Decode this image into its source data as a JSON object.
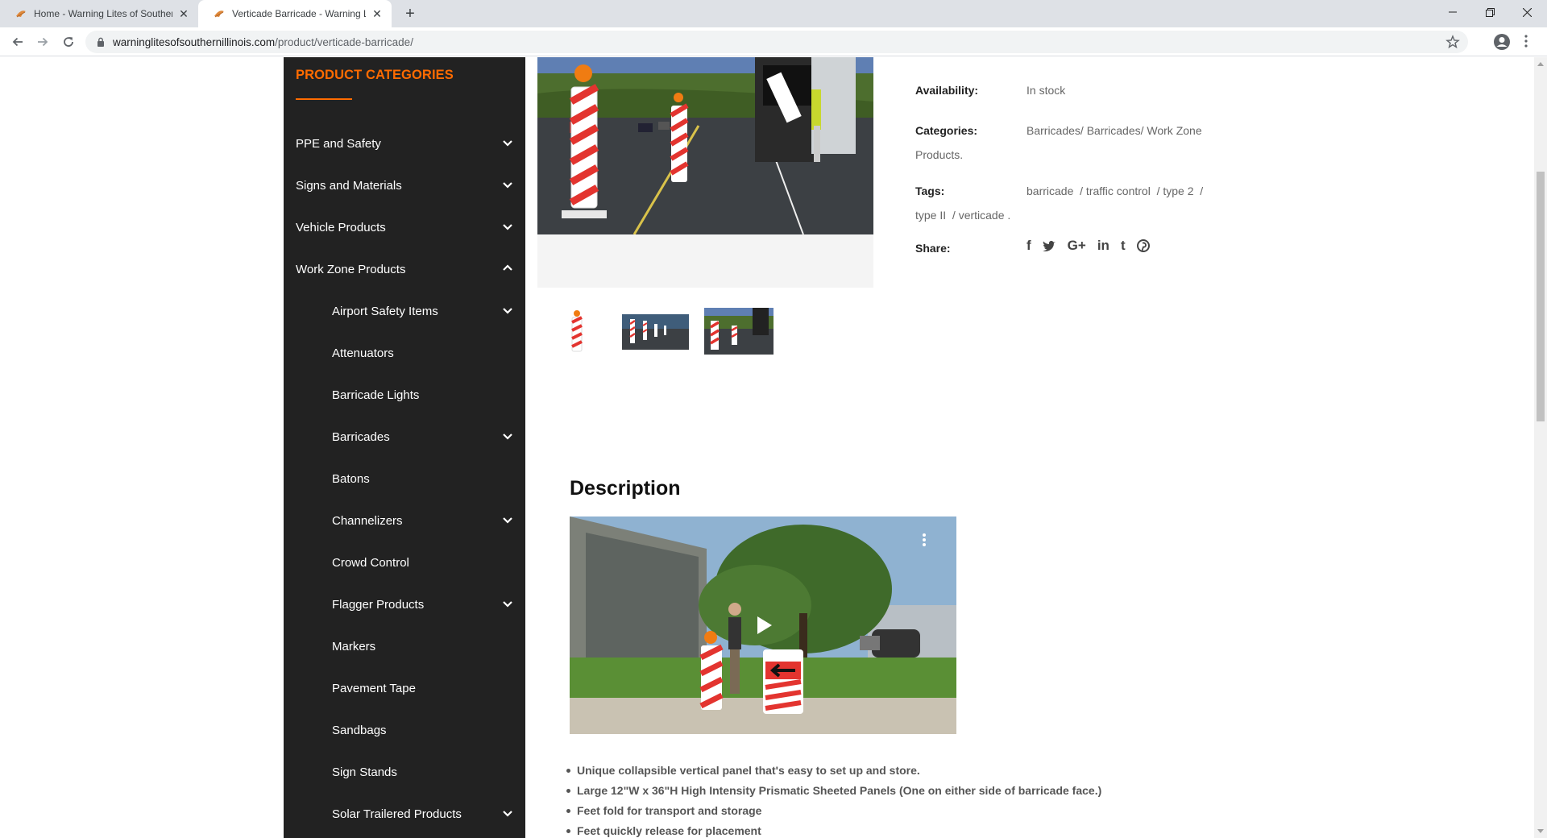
{
  "browser": {
    "tabs": [
      {
        "title": "Home - Warning Lites of Southern Illinois",
        "active": false
      },
      {
        "title": "Verticade Barricade - Warning Lites of Southern Illinois",
        "active": true
      }
    ],
    "url_domain": "warninglitesofsouthernillinois.com",
    "url_path": "/product/verticade-barricade/"
  },
  "sidebar": {
    "title": "PRODUCT CATEGORIES",
    "items": [
      {
        "label": "PPE and Safety",
        "level": 0,
        "expand": "down"
      },
      {
        "label": "Signs and Materials",
        "level": 0,
        "expand": "down"
      },
      {
        "label": "Vehicle Products",
        "level": 0,
        "expand": "down"
      },
      {
        "label": "Work Zone Products",
        "level": 0,
        "expand": "up"
      },
      {
        "label": "Airport Safety Items",
        "level": 1,
        "expand": "down"
      },
      {
        "label": "Attenuators",
        "level": 1,
        "expand": ""
      },
      {
        "label": "Barricade Lights",
        "level": 1,
        "expand": ""
      },
      {
        "label": "Barricades",
        "level": 1,
        "expand": "down"
      },
      {
        "label": "Batons",
        "level": 1,
        "expand": ""
      },
      {
        "label": "Channelizers",
        "level": 1,
        "expand": "down"
      },
      {
        "label": "Crowd Control",
        "level": 1,
        "expand": ""
      },
      {
        "label": "Flagger Products",
        "level": 1,
        "expand": "down"
      },
      {
        "label": "Markers",
        "level": 1,
        "expand": ""
      },
      {
        "label": "Pavement Tape",
        "level": 1,
        "expand": ""
      },
      {
        "label": "Sandbags",
        "level": 1,
        "expand": ""
      },
      {
        "label": "Sign Stands",
        "level": 1,
        "expand": ""
      },
      {
        "label": "Solar Trailered Products",
        "level": 1,
        "expand": "down"
      }
    ]
  },
  "product": {
    "availability_label": "Availability:",
    "availability_value": "In stock",
    "categories_label": "Categories:",
    "categories_line1": "Barricades/ Barricades/ Work Zone",
    "categories_line2": "Products.",
    "tags_label": "Tags:",
    "tags_line1": "barricade  / traffic control  / type 2  /",
    "tags_line2": "type II  / verticade .",
    "share_label": "Share:",
    "share_icons": [
      "f",
      "t",
      "G+",
      "in",
      "t",
      "p"
    ]
  },
  "description": {
    "title": "Description",
    "bullets": [
      "Unique collapsible vertical panel that's easy to set up and store.",
      "Large 12\"W x 36\"H High Intensity Prismatic Sheeted Panels (One on either side of barricade face.)",
      "Feet fold for transport and storage",
      "Feet quickly release for placement"
    ]
  },
  "colors": {
    "accent": "#ff6b00",
    "sidebar_bg": "#222222"
  }
}
